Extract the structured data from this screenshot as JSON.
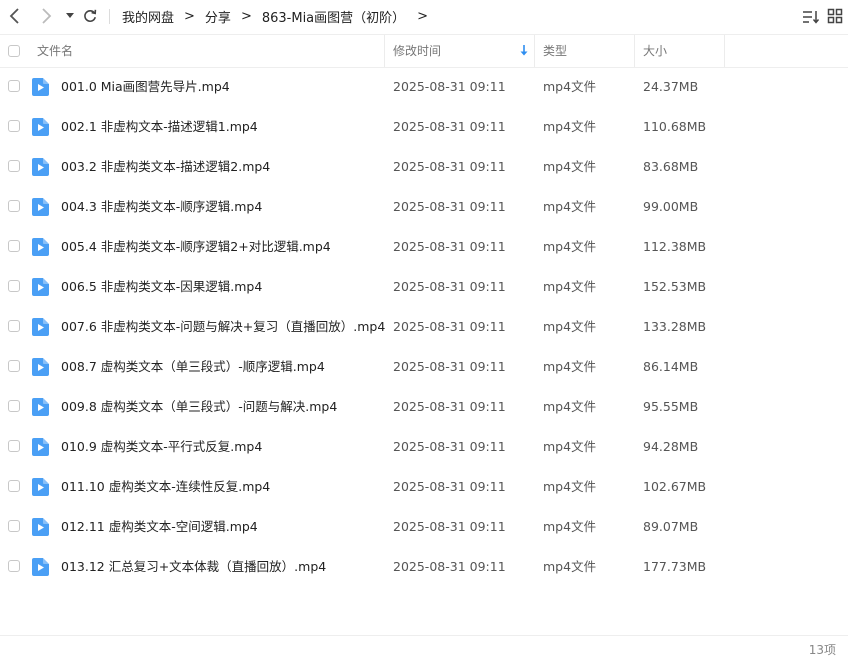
{
  "nav": {
    "back_icon": "chevron-left-icon",
    "forward_icon": "chevron-right-icon",
    "dropdown_icon": "caret-down-icon",
    "refresh_icon": "refresh-icon"
  },
  "breadcrumb": {
    "items": [
      "我的网盘",
      "分享",
      "863-Mia画图营（初阶）"
    ],
    "separator": ">"
  },
  "toolbar": {
    "sort_icon": "sort-list-icon",
    "view_icon": "grid-view-icon"
  },
  "table": {
    "headers": {
      "name": "文件名",
      "modified": "修改时间",
      "type": "类型",
      "size": "大小"
    },
    "sorted_by": "modified",
    "rows": [
      {
        "name": "001.0 Mia画图营先导片.mp4",
        "modified": "2025-08-31 09:11",
        "type": "mp4文件",
        "size": "24.37MB"
      },
      {
        "name": "002.1 非虚构文本-描述逻辑1.mp4",
        "modified": "2025-08-31 09:11",
        "type": "mp4文件",
        "size": "110.68MB"
      },
      {
        "name": "003.2 非虚构类文本-描述逻辑2.mp4",
        "modified": "2025-08-31 09:11",
        "type": "mp4文件",
        "size": "83.68MB"
      },
      {
        "name": "004.3 非虚构类文本-顺序逻辑.mp4",
        "modified": "2025-08-31 09:11",
        "type": "mp4文件",
        "size": "99.00MB"
      },
      {
        "name": "005.4 非虚构类文本-顺序逻辑2+对比逻辑.mp4",
        "modified": "2025-08-31 09:11",
        "type": "mp4文件",
        "size": "112.38MB"
      },
      {
        "name": "006.5 非虚构类文本-因果逻辑.mp4",
        "modified": "2025-08-31 09:11",
        "type": "mp4文件",
        "size": "152.53MB"
      },
      {
        "name": "007.6 非虚构类文本-问题与解决+复习（直播回放）.mp4",
        "modified": "2025-08-31 09:11",
        "type": "mp4文件",
        "size": "133.28MB"
      },
      {
        "name": "008.7 虚构类文本（单三段式）-顺序逻辑.mp4",
        "modified": "2025-08-31 09:11",
        "type": "mp4文件",
        "size": "86.14MB"
      },
      {
        "name": "009.8 虚构类文本（单三段式）-问题与解决.mp4",
        "modified": "2025-08-31 09:11",
        "type": "mp4文件",
        "size": "95.55MB"
      },
      {
        "name": "010.9 虚构类文本-平行式反复.mp4",
        "modified": "2025-08-31 09:11",
        "type": "mp4文件",
        "size": "94.28MB"
      },
      {
        "name": "011.10 虚构类文本-连续性反复.mp4",
        "modified": "2025-08-31 09:11",
        "type": "mp4文件",
        "size": "102.67MB"
      },
      {
        "name": "012.11 虚构类文本-空间逻辑.mp4",
        "modified": "2025-08-31 09:11",
        "type": "mp4文件",
        "size": "89.07MB"
      },
      {
        "name": "013.12 汇总复习+文本体裁（直播回放）.mp4",
        "modified": "2025-08-31 09:11",
        "type": "mp4文件",
        "size": "177.73MB"
      }
    ]
  },
  "footer": {
    "count": "13项"
  },
  "colors": {
    "file_icon": "#4a9ff5",
    "sort_arrow": "#2e8ef0",
    "border": "#eeeeee"
  }
}
